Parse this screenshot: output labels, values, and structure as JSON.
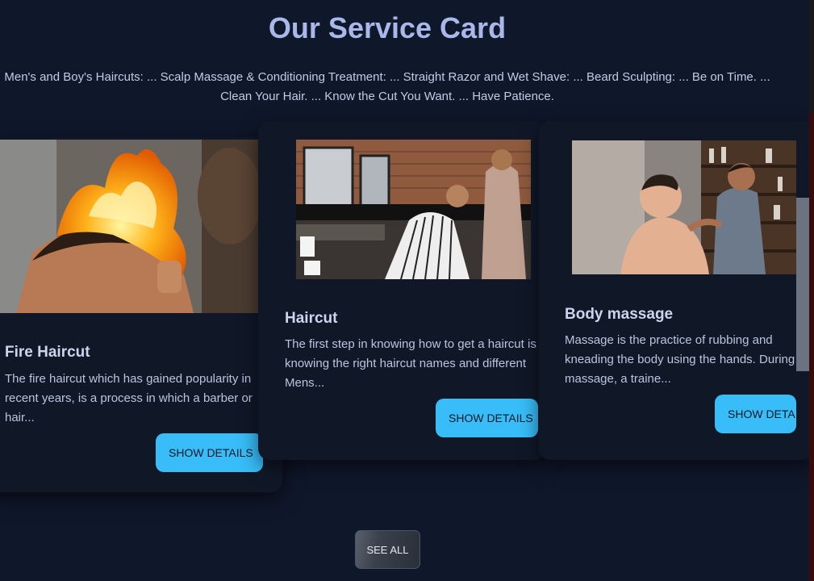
{
  "section": {
    "title": "Our Service Card",
    "subtitle_line1": "Men's and Boy's Haircuts: ... Scalp Massage & Conditioning Treatment: ... Straight Razor and Wet Shave: ... Beard Sculpting: ... Be on Time. ...",
    "subtitle_line2": "Clean Your Hair. ... Know the Cut You Want. ... Have Patience."
  },
  "cards": [
    {
      "title": "Fire Haircut",
      "description": "The fire haircut which has gained popularity in recent years, is a process in which a barber or hair...",
      "button": "SHOW DETAILS",
      "image": "fire-haircut-photo"
    },
    {
      "title": "Haircut",
      "description": "The first step in knowing how to get a haircut is knowing the right haircut names and different Mens...",
      "button": "SHOW DETAILS",
      "image": "barbershop-photo"
    },
    {
      "title": "Body massage",
      "description": "Massage is the practice of rubbing and kneading the body using the hands. During massage, a traine...",
      "button": "SHOW DETAILS",
      "image": "massage-photo"
    }
  ],
  "see_all": "SEE ALL",
  "colors": {
    "background": "#0f172a",
    "card": "#101828",
    "accent": "#38bdf8",
    "title": "#a9b8e8"
  }
}
